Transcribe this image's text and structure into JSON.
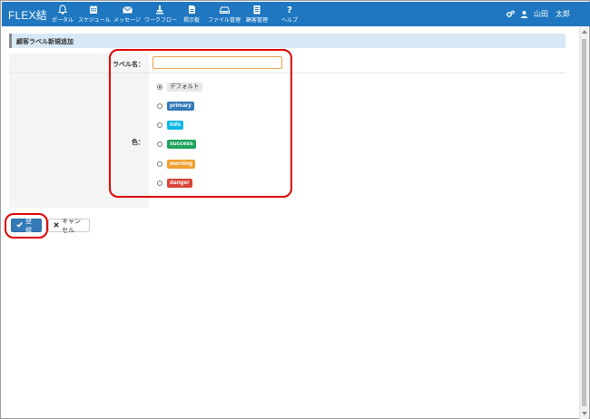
{
  "app": {
    "brand": "FLEX結"
  },
  "nav": {
    "items": [
      {
        "label": "ポータル",
        "icon": "bell-icon"
      },
      {
        "label": "スケジュール",
        "icon": "calendar-icon"
      },
      {
        "label": "メッセージ",
        "icon": "envelope-icon"
      },
      {
        "label": "ワークフロー",
        "icon": "workflow-icon"
      },
      {
        "label": "掲示板",
        "icon": "board-icon"
      },
      {
        "label": "ファイル管理",
        "icon": "drive-icon"
      },
      {
        "label": "顧客管理",
        "icon": "customer-icon"
      },
      {
        "label": "ヘルプ",
        "icon": "question-icon"
      }
    ]
  },
  "user": {
    "name": "山田　太郎",
    "settings_icon": "cogs-icon",
    "user_icon": "user-icon"
  },
  "panel": {
    "title": "顧客ラベル新規追加"
  },
  "form": {
    "label_name": "ラベル名：",
    "label_value": "",
    "color_label": "色：",
    "options": [
      {
        "label": "デフォルト",
        "color": "#e8e8e8",
        "text_color": "#333333",
        "checked": true
      },
      {
        "label": "primary",
        "color": "#337ab7",
        "text_color": "#ffffff",
        "checked": false
      },
      {
        "label": "info",
        "color": "#0ab8e8",
        "text_color": "#ffffff",
        "checked": false
      },
      {
        "label": "success",
        "color": "#1fa35b",
        "text_color": "#ffffff",
        "checked": false
      },
      {
        "label": "warning",
        "color": "#f0a030",
        "text_color": "#ffffff",
        "checked": false
      },
      {
        "label": "danger",
        "color": "#d9453a",
        "text_color": "#ffffff",
        "checked": false
      }
    ]
  },
  "buttons": {
    "submit": "登録",
    "cancel": "キャンセル"
  },
  "colors": {
    "navbar": "#1e77c0",
    "highlight": "#e00000",
    "panel_title_bg": "#d8e8f5"
  }
}
